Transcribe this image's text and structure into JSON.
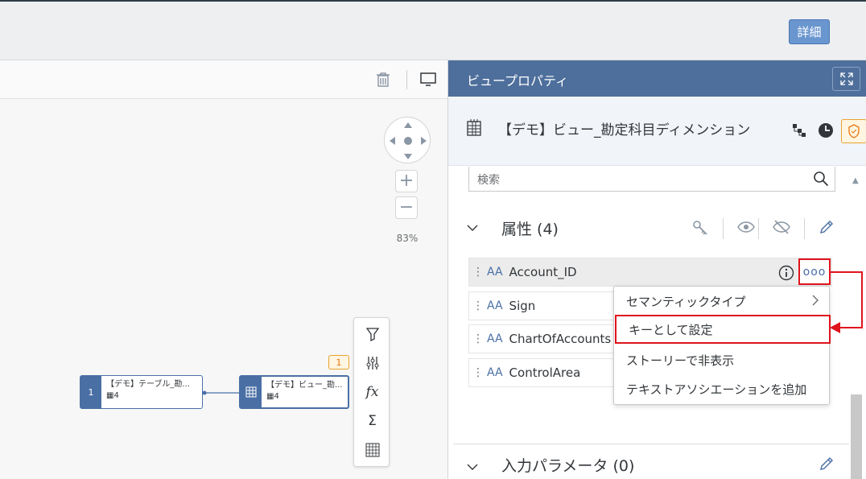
{
  "topbar": {
    "detail_button": "詳細"
  },
  "canvas": {
    "zoom_level": "83%",
    "nodes": [
      {
        "tag": "1",
        "title": "【デモ】テーブル_勘...",
        "count": "4"
      },
      {
        "tag": "",
        "title": "【デモ】ビュー_勘...",
        "count": "4"
      }
    ],
    "node_badge": "1",
    "tools": [
      "filter-icon",
      "sliders-icon",
      "fx-icon",
      "sum-icon",
      "grid-icon"
    ],
    "fx_label": "fx",
    "sum_label": "Σ"
  },
  "panel": {
    "title": "ビュープロパティ",
    "view_name": "【デモ】ビュー_勘定科目ディメンション",
    "search_placeholder": "検索",
    "attributes_section": "属性 (4)",
    "attributes": [
      {
        "type": "AA",
        "name": "Account_ID"
      },
      {
        "type": "AA",
        "name": "Sign"
      },
      {
        "type": "AA",
        "name": "ChartOfAccounts"
      },
      {
        "type": "AA",
        "name": "ControlArea"
      }
    ],
    "more_label": "ooo",
    "input_params_section": "入力パラメータ (0)"
  },
  "context_menu": {
    "items": [
      "セマンティックタイプ",
      "キーとして設定",
      "ストーリーで非表示",
      "テキストアソシエーションを追加"
    ]
  },
  "colors": {
    "accent": "#4e6f9c",
    "highlight": "#e0141d",
    "button": "#6a96cf"
  }
}
